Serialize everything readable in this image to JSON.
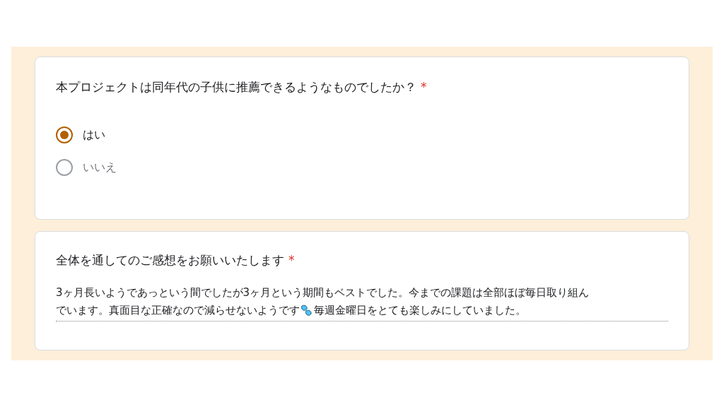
{
  "questions": [
    {
      "kind": "radio",
      "title": "本プロジェクトは同年代の子供に推薦できるようなものでしたか？",
      "required_mark": "*",
      "options": [
        {
          "label": "はい",
          "selected": true
        },
        {
          "label": "いいえ",
          "selected": false
        }
      ]
    },
    {
      "kind": "text",
      "title": "全体を通してのご感想をお願いいたします",
      "required_mark": "*",
      "answer_lines": [
        "3ヶ月長いようであっという間でしたが3ヶ月という期間もベストでした。今までの課題は全部ほぼ毎日取り組ん",
        "でいます。真面目な正確なので減らせないようです",
        "毎週金曜日をとても楽しみにしていました。"
      ]
    }
  ]
}
